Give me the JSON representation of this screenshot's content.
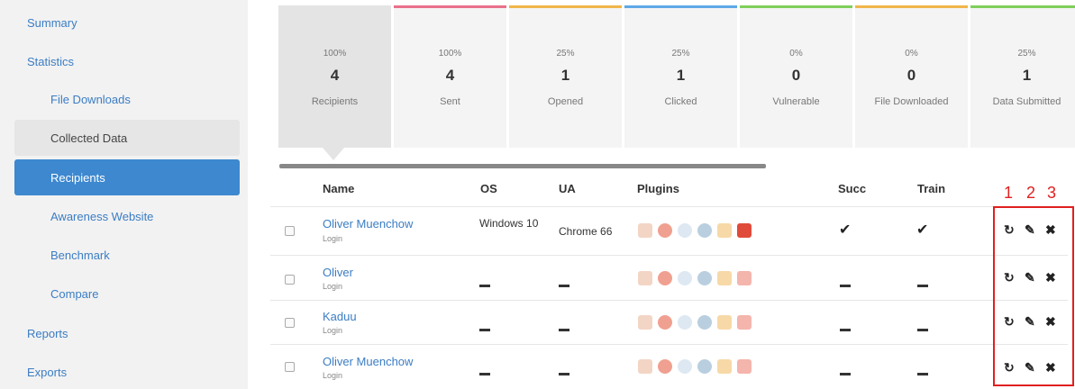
{
  "sidebar": {
    "items": [
      {
        "label": "Summary"
      },
      {
        "label": "Statistics"
      },
      {
        "label": "File Downloads"
      },
      {
        "label": "Collected Data"
      },
      {
        "label": "Recipients"
      },
      {
        "label": "Awareness Website"
      },
      {
        "label": "Benchmark"
      },
      {
        "label": "Compare"
      },
      {
        "label": "Reports"
      },
      {
        "label": "Exports"
      }
    ]
  },
  "tiles": [
    {
      "pct": "100%",
      "num": "4",
      "label": "Recipients",
      "color": "#e4e4e4"
    },
    {
      "pct": "100%",
      "num": "4",
      "label": "Sent",
      "color": "#e8708a"
    },
    {
      "pct": "25%",
      "num": "1",
      "label": "Opened",
      "color": "#f0b64a"
    },
    {
      "pct": "25%",
      "num": "1",
      "label": "Clicked",
      "color": "#5ea8e6"
    },
    {
      "pct": "0%",
      "num": "0",
      "label": "Vulnerable",
      "color": "#7fcf5a"
    },
    {
      "pct": "0%",
      "num": "0",
      "label": "File Downloaded",
      "color": "#f0b64a"
    },
    {
      "pct": "25%",
      "num": "1",
      "label": "Data Submitted",
      "color": "#7fcf5a"
    }
  ],
  "table": {
    "headers": {
      "name": "Name",
      "os": "OS",
      "ua": "UA",
      "plugins": "Plugins",
      "succ": "Succ",
      "train": "Train"
    },
    "rows": [
      {
        "name": "Oliver Muenchow",
        "sub": "Login",
        "os": "Windows 10",
        "ua": "Chrome 66",
        "succ": "✔",
        "train": "✔"
      },
      {
        "name": "Oliver",
        "sub": "Login",
        "os": "",
        "ua": "",
        "succ": "",
        "train": ""
      },
      {
        "name": "Kaduu",
        "sub": "Login",
        "os": "",
        "ua": "",
        "succ": "",
        "train": ""
      },
      {
        "name": "Oliver Muenchow",
        "sub": "Login",
        "os": "",
        "ua": "",
        "succ": "",
        "train": ""
      }
    ]
  },
  "actions": {
    "refresh_icon": "↻",
    "edit_icon": "✎",
    "delete_icon": "✖"
  },
  "annotations": [
    "1",
    "2",
    "3"
  ]
}
